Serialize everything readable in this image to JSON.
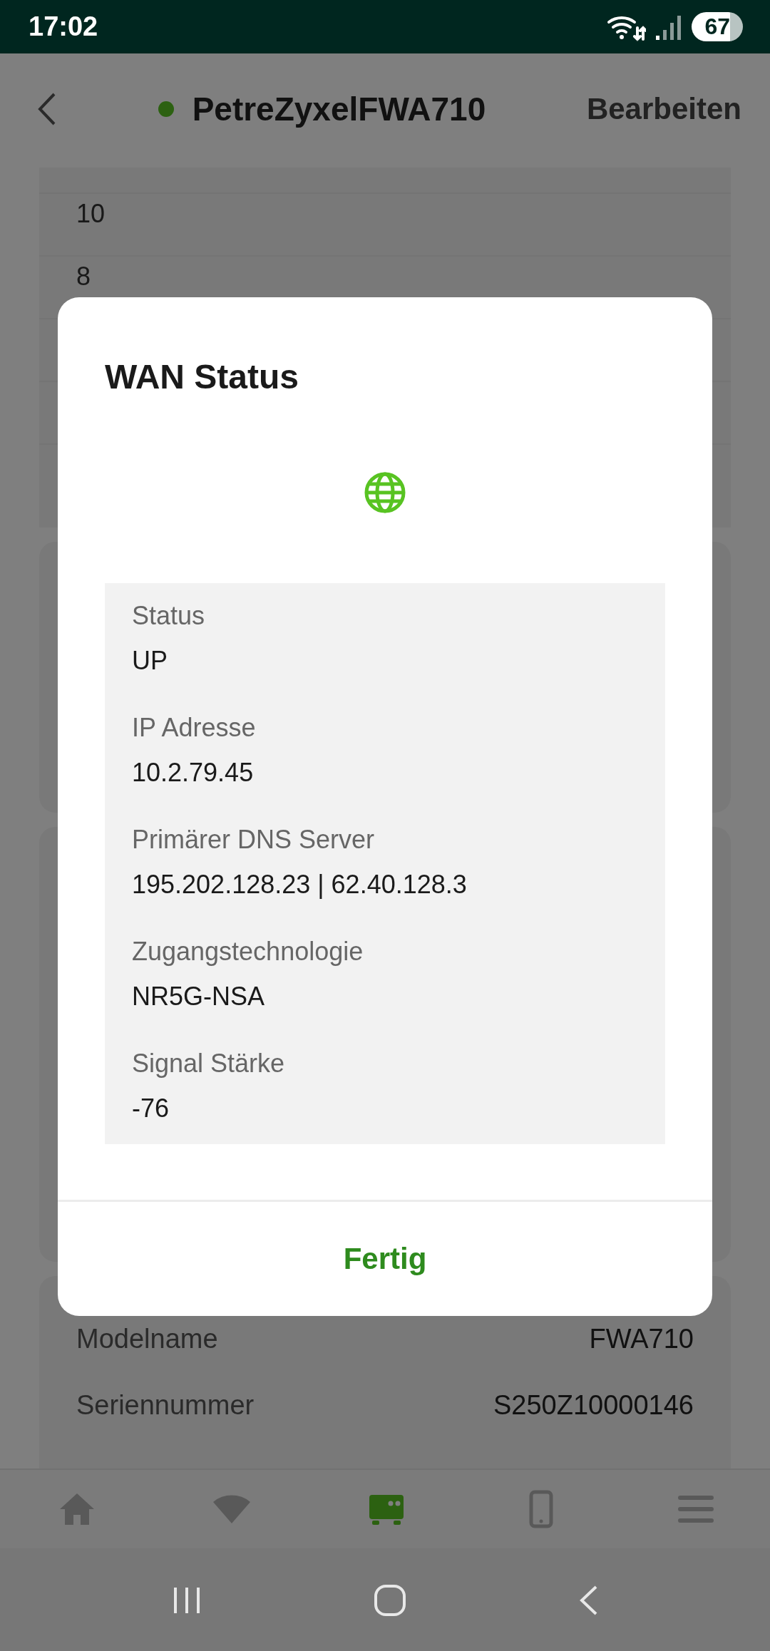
{
  "status_bar": {
    "time": "17:02",
    "battery": "67"
  },
  "header": {
    "title": "PetreZyxelFWA710",
    "online": true,
    "action": "Bearbeiten"
  },
  "chart_axis_labels": [
    "10",
    "8"
  ],
  "device_info": [
    {
      "label": "Modelname",
      "value": "FWA710"
    },
    {
      "label": "Seriennummer",
      "value": "S250Z10000146"
    }
  ],
  "bottom_nav": [
    {
      "kind": "home",
      "selected": false
    },
    {
      "kind": "wifi",
      "selected": false
    },
    {
      "kind": "router",
      "selected": true
    },
    {
      "kind": "phone",
      "selected": false
    },
    {
      "kind": "menu",
      "selected": false
    }
  ],
  "dialog": {
    "title": "WAN Status",
    "fields": [
      {
        "label": "Status",
        "value": "UP"
      },
      {
        "label": "IP Adresse",
        "value": "10.2.79.45"
      },
      {
        "label": "Primärer DNS Server",
        "value": "195.202.128.23 | 62.40.128.3"
      },
      {
        "label": "Zugangstechnologie",
        "value": "NR5G-NSA"
      },
      {
        "label": "Signal Stärke",
        "value": "-76"
      }
    ],
    "button": "Fertig"
  }
}
